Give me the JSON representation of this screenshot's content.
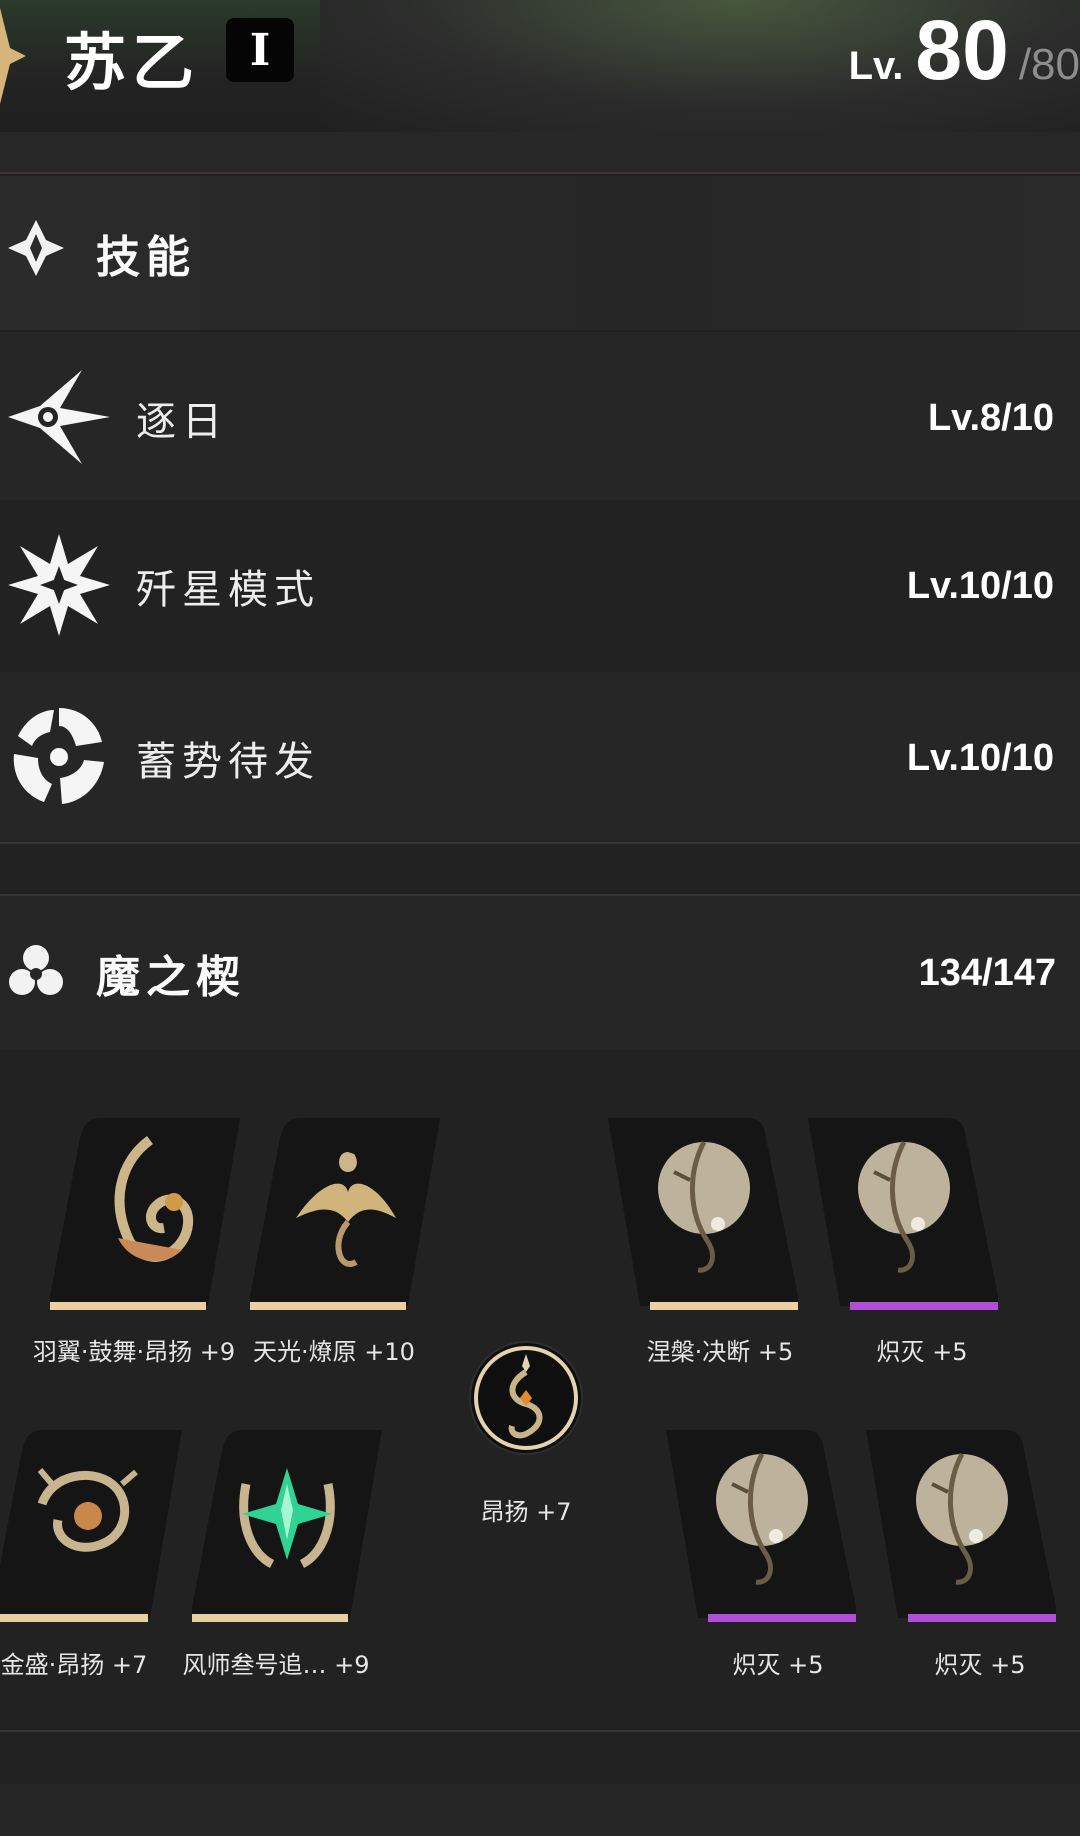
{
  "header": {
    "character_name": "苏乙",
    "rank_badge": "I",
    "level_prefix": "Lv.",
    "level_current": "80",
    "level_max": "/80"
  },
  "skills_section": {
    "title": "技能",
    "items": [
      {
        "name": "逐日",
        "level": "Lv.8/10"
      },
      {
        "name": "歼星模式",
        "level": "Lv.10/10"
      },
      {
        "name": "蓄势待发",
        "level": "Lv.10/10"
      }
    ]
  },
  "wedge_section": {
    "title": "魔之楔",
    "count": "134/147",
    "slots": [
      {
        "label": "羽翼·鼓舞·昂扬 +9",
        "rarity": "gold"
      },
      {
        "label": "天光·燎原 +10",
        "rarity": "gold"
      },
      {
        "label": "涅槃·决断 +5",
        "rarity": "gold"
      },
      {
        "label": "炽灭 +5",
        "rarity": "purple"
      },
      {
        "label": "金盛·昂扬 +7",
        "rarity": "gold"
      },
      {
        "label": "风师叁号追…  +9",
        "rarity": "gold"
      },
      {
        "label": "炽灭 +5",
        "rarity": "purple"
      },
      {
        "label": "炽灭 +5",
        "rarity": "purple"
      }
    ],
    "center": {
      "label": "昂扬 +7"
    }
  },
  "colors": {
    "gold_bar": "#e9cfa1",
    "purple_bar": "#b24dda",
    "card_bg": "#151515"
  }
}
